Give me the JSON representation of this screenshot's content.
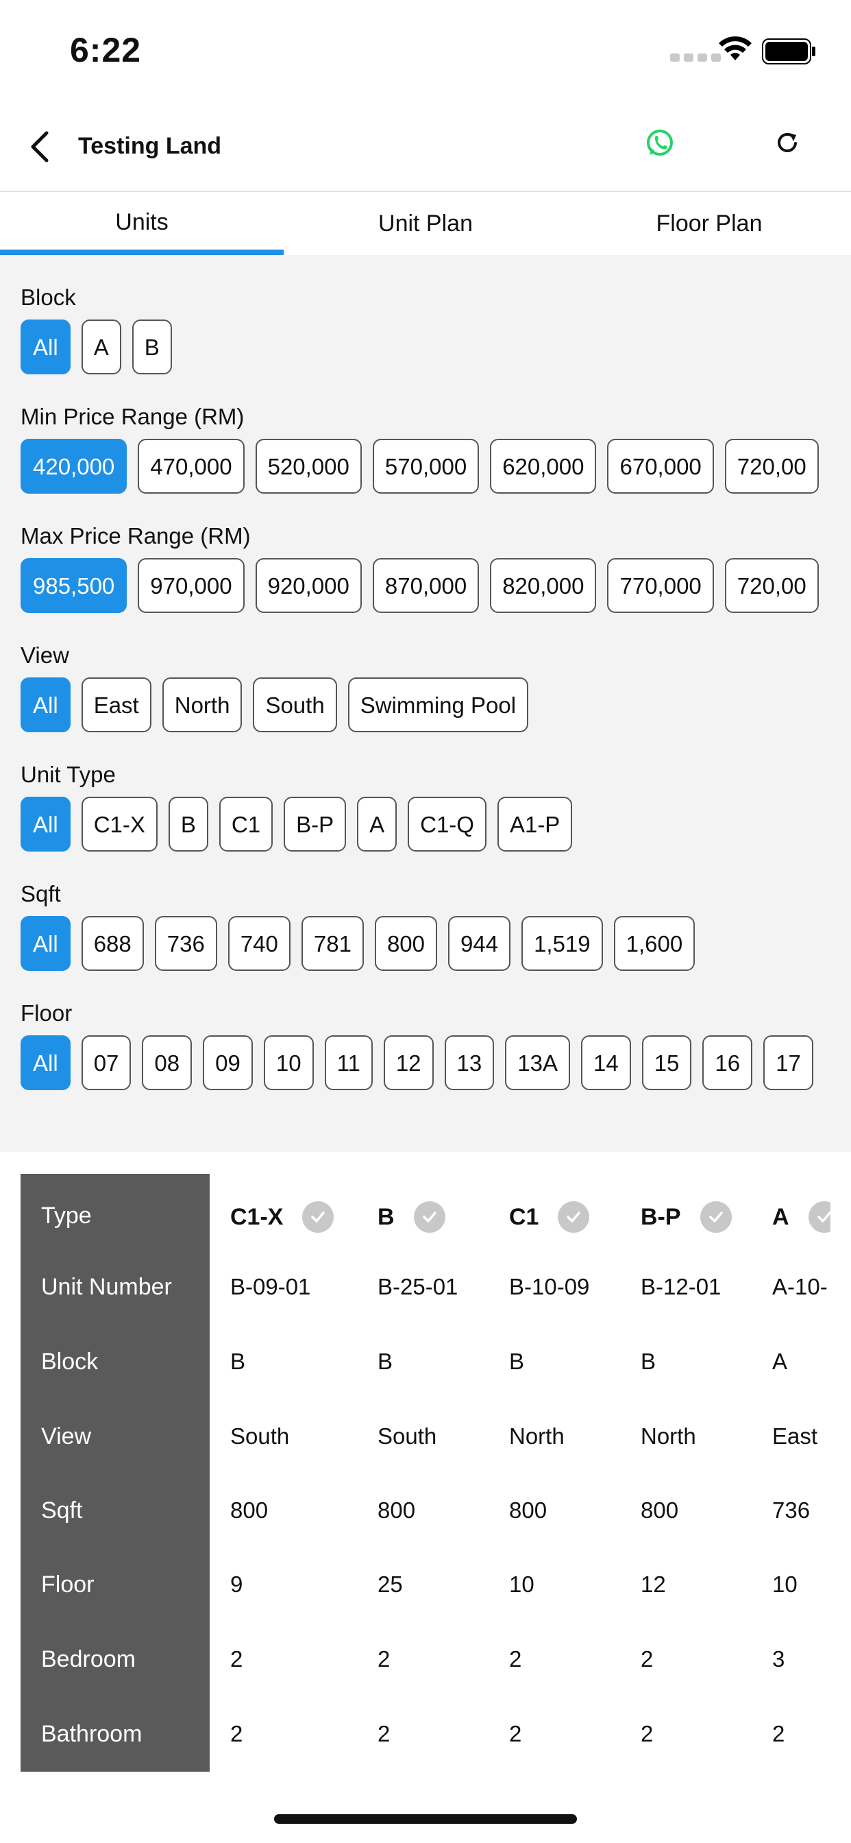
{
  "status_bar": {
    "time": "6:22"
  },
  "header": {
    "title": "Testing Land"
  },
  "tabs": [
    {
      "label": "Units",
      "active": true
    },
    {
      "label": "Unit Plan",
      "active": false
    },
    {
      "label": "Floor Plan",
      "active": false
    }
  ],
  "filters": {
    "block": {
      "label": "Block",
      "options": [
        "All",
        "A",
        "B"
      ],
      "selected": "All"
    },
    "min_price": {
      "label": "Min Price Range (RM)",
      "options": [
        "420,000",
        "470,000",
        "520,000",
        "570,000",
        "620,000",
        "670,000",
        "720,00"
      ],
      "selected": "420,000"
    },
    "max_price": {
      "label": "Max Price Range (RM)",
      "options": [
        "985,500",
        "970,000",
        "920,000",
        "870,000",
        "820,000",
        "770,000",
        "720,00"
      ],
      "selected": "985,500"
    },
    "view": {
      "label": "View",
      "options": [
        "All",
        "East",
        "North",
        "South",
        "Swimming Pool"
      ],
      "selected": "All"
    },
    "unit_type": {
      "label": "Unit Type",
      "options": [
        "All",
        "C1-X",
        "B",
        "C1",
        "B-P",
        "A",
        "C1-Q",
        "A1-P"
      ],
      "selected": "All"
    },
    "sqft": {
      "label": "Sqft",
      "options": [
        "All",
        "688",
        "736",
        "740",
        "781",
        "800",
        "944",
        "1,519",
        "1,600"
      ],
      "selected": "All"
    },
    "floor": {
      "label": "Floor",
      "options": [
        "All",
        "07",
        "08",
        "09",
        "10",
        "11",
        "12",
        "13",
        "13A",
        "14",
        "15",
        "16",
        "17"
      ],
      "selected": "All"
    }
  },
  "table": {
    "row_headers": [
      "Type",
      "Unit Number",
      "Block",
      "View",
      "Sqft",
      "Floor",
      "Bedroom",
      "Bathroom"
    ],
    "units": [
      {
        "type": "C1-X",
        "unit_number": "B-09-01",
        "block": "B",
        "view": "South",
        "sqft": "800",
        "floor": "9",
        "bedroom": "2",
        "bathroom": "2"
      },
      {
        "type": "B",
        "unit_number": "B-25-01",
        "block": "B",
        "view": "South",
        "sqft": "800",
        "floor": "25",
        "bedroom": "2",
        "bathroom": "2"
      },
      {
        "type": "C1",
        "unit_number": "B-10-09",
        "block": "B",
        "view": "North",
        "sqft": "800",
        "floor": "10",
        "bedroom": "2",
        "bathroom": "2"
      },
      {
        "type": "B-P",
        "unit_number": "B-12-01",
        "block": "B",
        "view": "North",
        "sqft": "800",
        "floor": "12",
        "bedroom": "2",
        "bathroom": "2"
      },
      {
        "type": "A",
        "unit_number": "A-10-",
        "block": "A",
        "view": "East",
        "sqft": "736",
        "floor": "10",
        "bedroom": "3",
        "bathroom": "2"
      }
    ]
  },
  "icons": {
    "back": "chevron-left-icon",
    "whatsapp": "whatsapp-icon",
    "refresh": "refresh-icon",
    "check": "check-circle-icon"
  },
  "colors": {
    "accent": "#1e90e6",
    "whatsapp": "#25d366",
    "header_column": "#5a5a5a"
  }
}
